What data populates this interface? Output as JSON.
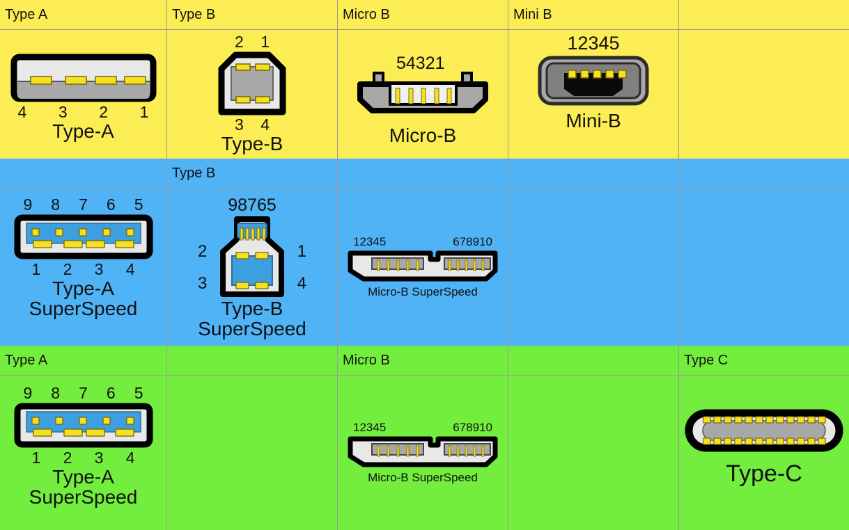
{
  "title": "USB connector types comparison table",
  "colors": {
    "usb2_row": "#fced54",
    "usb3_row": "#4fb3f6",
    "usb31_row": "#73ed3e",
    "pin_yellow": "#f5e023",
    "shell_light": "#e8e8e8",
    "shell_gray": "#a8a8a8",
    "insert_blue": "#3d9fe0",
    "outline_black": "#000000",
    "grid_line": "#9a9a9a"
  },
  "rows": [
    {
      "id": "usb2",
      "background": "#fced54",
      "headers": [
        "Type A",
        "Type B",
        "Micro B",
        "Mini B",
        ""
      ],
      "cells": [
        {
          "connector": "type-a",
          "caption": "Type-A",
          "pins_bottom": [
            "4",
            "3",
            "2",
            "1"
          ],
          "pins_top": []
        },
        {
          "connector": "type-b",
          "caption": "Type-B",
          "pins_top": [
            "2",
            "1"
          ],
          "pins_bottom": [
            "3",
            "4"
          ]
        },
        {
          "connector": "micro-b",
          "caption": "Micro-B",
          "pins_top": [
            "54321"
          ],
          "pins_bottom": []
        },
        {
          "connector": "mini-b",
          "caption": "Mini-B",
          "pins_top": [
            "12345"
          ],
          "pins_bottom": []
        },
        {
          "connector": "none",
          "caption": "",
          "pins_top": [],
          "pins_bottom": []
        }
      ]
    },
    {
      "id": "usb3",
      "background": "#4fb3f6",
      "headers": [
        "",
        "Type B",
        "",
        "",
        ""
      ],
      "cells": [
        {
          "connector": "type-a-ss",
          "caption": "Type-A\nSuperSpeed",
          "pins_top": [
            "9",
            "8",
            "7",
            "6",
            "5"
          ],
          "pins_bottom": [
            "1",
            "2",
            "3",
            "4"
          ]
        },
        {
          "connector": "type-b-ss",
          "caption": "Type-B\nSuperSpeed",
          "pins_top": [
            "98765"
          ],
          "pins_left": [
            "2",
            "3"
          ],
          "pins_right": [
            "1",
            "4"
          ]
        },
        {
          "connector": "micro-b-ss",
          "caption": "Micro-B SuperSpeed",
          "pins_left_label": "12345",
          "pins_right_label": "678910"
        },
        {
          "connector": "none",
          "caption": ""
        },
        {
          "connector": "none",
          "caption": ""
        }
      ]
    },
    {
      "id": "usb31",
      "background": "#73ed3e",
      "headers": [
        "Type A",
        "",
        "Micro B",
        "",
        "Type C"
      ],
      "cells": [
        {
          "connector": "type-a-ss",
          "caption": "Type-A\nSuperSpeed",
          "pins_top": [
            "9",
            "8",
            "7",
            "6",
            "5"
          ],
          "pins_bottom": [
            "1",
            "2",
            "3",
            "4"
          ]
        },
        {
          "connector": "none",
          "caption": ""
        },
        {
          "connector": "micro-b-ss",
          "caption": "Micro-B SuperSpeed",
          "pins_left_label": "12345",
          "pins_right_label": "678910"
        },
        {
          "connector": "none",
          "caption": ""
        },
        {
          "connector": "type-c",
          "caption": "Type-C",
          "pin_count_per_row": 12
        }
      ]
    }
  ]
}
